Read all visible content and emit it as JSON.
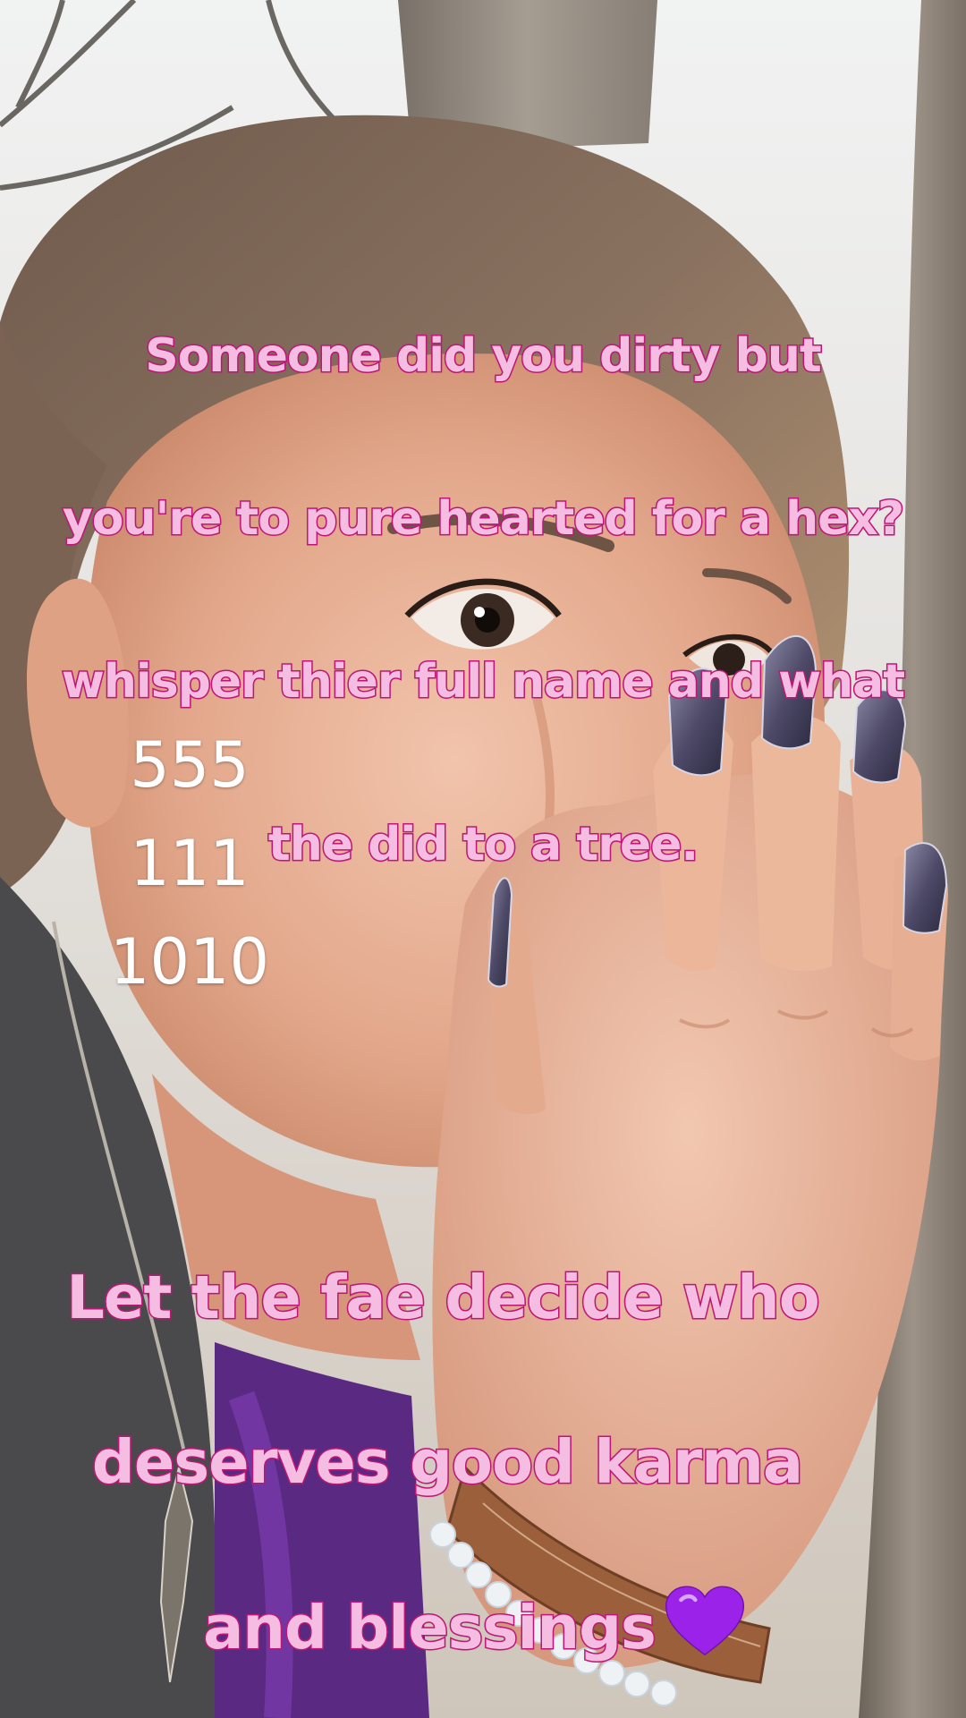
{
  "caption_top": {
    "line1": "Someone did you dirty but",
    "line2": "you're to pure hearted for a hex?",
    "line3": "whisper thier full name and what",
    "line4": "the did to a tree."
  },
  "numbers": [
    "555",
    "111",
    "1010"
  ],
  "caption_bottom": {
    "line1": "Let the fae decide who",
    "line2": "deserves good karma",
    "line3": "and blessings"
  },
  "emoji": {
    "name": "purple-heart-icon",
    "color": "#9b22e8"
  },
  "colors": {
    "caption_fill": "#f6bde3",
    "caption_stroke": "#c2187a",
    "numbers": "#ffffff"
  }
}
